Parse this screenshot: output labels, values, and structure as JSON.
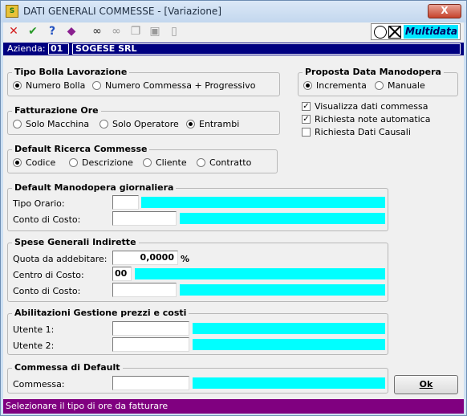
{
  "window": {
    "title": "DATI GENERALI COMMESSE - [Variazione]",
    "close_label": "X",
    "app_icon_text": "S"
  },
  "toolbar": {
    "icons": [
      "close-icon",
      "check-icon",
      "help-icon",
      "book-icon",
      "binoculars-icon",
      "binoculars-cross-icon",
      "copy-icon",
      "paste-icon",
      "new-page-icon"
    ],
    "logo_text": "Multidata"
  },
  "azienda": {
    "label": "Azienda:",
    "code": "01",
    "name": "SOGESE SRL"
  },
  "tipo_bolla": {
    "title": "Tipo Bolla Lavorazione",
    "options": [
      "Numero Bolla",
      "Numero Commessa + Progressivo"
    ],
    "selected": 0
  },
  "proposta_data": {
    "title": "Proposta Data Manodopera",
    "options": [
      "Incrementa",
      "Manuale"
    ],
    "selected": 0
  },
  "checkboxes": [
    {
      "label": "Visualizza dati commessa",
      "checked": true
    },
    {
      "label": "Richiesta note automatica",
      "checked": true
    },
    {
      "label": "Richiesta Dati Causali",
      "checked": false
    }
  ],
  "fatturazione": {
    "title": "Fatturazione Ore",
    "options": [
      "Solo Macchina",
      "Solo Operatore",
      "Entrambi"
    ],
    "selected": 2
  },
  "ricerca": {
    "title": "Default Ricerca Commesse",
    "options": [
      "Codice",
      "Descrizione",
      "Cliente",
      "Contratto"
    ],
    "selected": 0
  },
  "manodopera": {
    "title": "Default Manodopera giornaliera",
    "tipo_orario_label": "Tipo Orario:",
    "conto_label": "Conto di Costo:"
  },
  "spese": {
    "title": "Spese Generali Indirette",
    "quota_label": "Quota da addebitare:",
    "quota_value": "0,0000",
    "percent": "%",
    "centro_label": "Centro di Costo:",
    "centro_value": "00",
    "conto_label": "Conto di Costo:"
  },
  "abilitazioni": {
    "title": "Abilitazioni Gestione prezzi e costi",
    "utente1_label": "Utente 1:",
    "utente2_label": "Utente 2:"
  },
  "commessa_default": {
    "title": "Commessa di Default",
    "label": "Commessa:"
  },
  "ok_label": "Ok",
  "status": "Selezionare il tipo di ore da fatturare",
  "colors": {
    "accent": "#000080",
    "lookup": "#00ffff",
    "status_bg": "#800080"
  }
}
